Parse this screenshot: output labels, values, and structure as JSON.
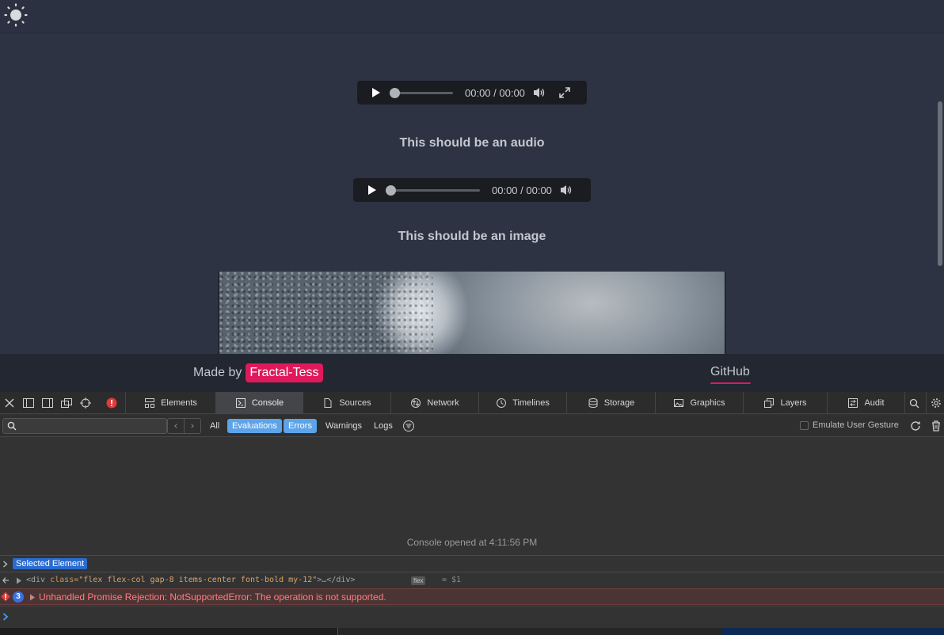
{
  "page": {
    "theme_toggle_icon": "sun-icon",
    "players": [
      {
        "time": "00:00 / 00:00",
        "icons": [
          "play-icon",
          "volume-icon",
          "fullscreen-icon"
        ]
      },
      {
        "time": "00:00 / 00:00",
        "icons": [
          "play-icon",
          "volume-icon"
        ]
      }
    ],
    "captions": [
      "This should be an audio",
      "This should be an image"
    ]
  },
  "footer": {
    "made_by": "Made by",
    "author": "Fractal-Tess",
    "github": "GitHub",
    "accent_color": "#e0195c"
  },
  "devtools": {
    "tabs": [
      "Elements",
      "Console",
      "Sources",
      "Network",
      "Timelines",
      "Storage",
      "Graphics",
      "Layers",
      "Audit"
    ],
    "active_tab": "Console",
    "filters": [
      "All",
      "Evaluations",
      "Errors",
      "Warnings",
      "Logs"
    ],
    "active_filters": [
      "Evaluations",
      "Errors"
    ],
    "search_placeholder": "",
    "emulate_gesture": "Emulate User Gesture",
    "console_opened": "Console opened at 4:11:56 PM",
    "selected_element": "Selected Element",
    "dom_snippet": {
      "open": "<div ",
      "attr": "class=",
      "value": "\"flex flex-col gap-8 items-center font-bold my-12\"",
      "close": ">…</div>",
      "badge": "flex",
      "ref": "= $1"
    },
    "error": {
      "count": "3",
      "message": "Unhandled Promise Rejection: NotSupportedError: The operation is not supported."
    },
    "error_color": "#ff7e7e",
    "filter_on_color": "#5da3e8"
  }
}
